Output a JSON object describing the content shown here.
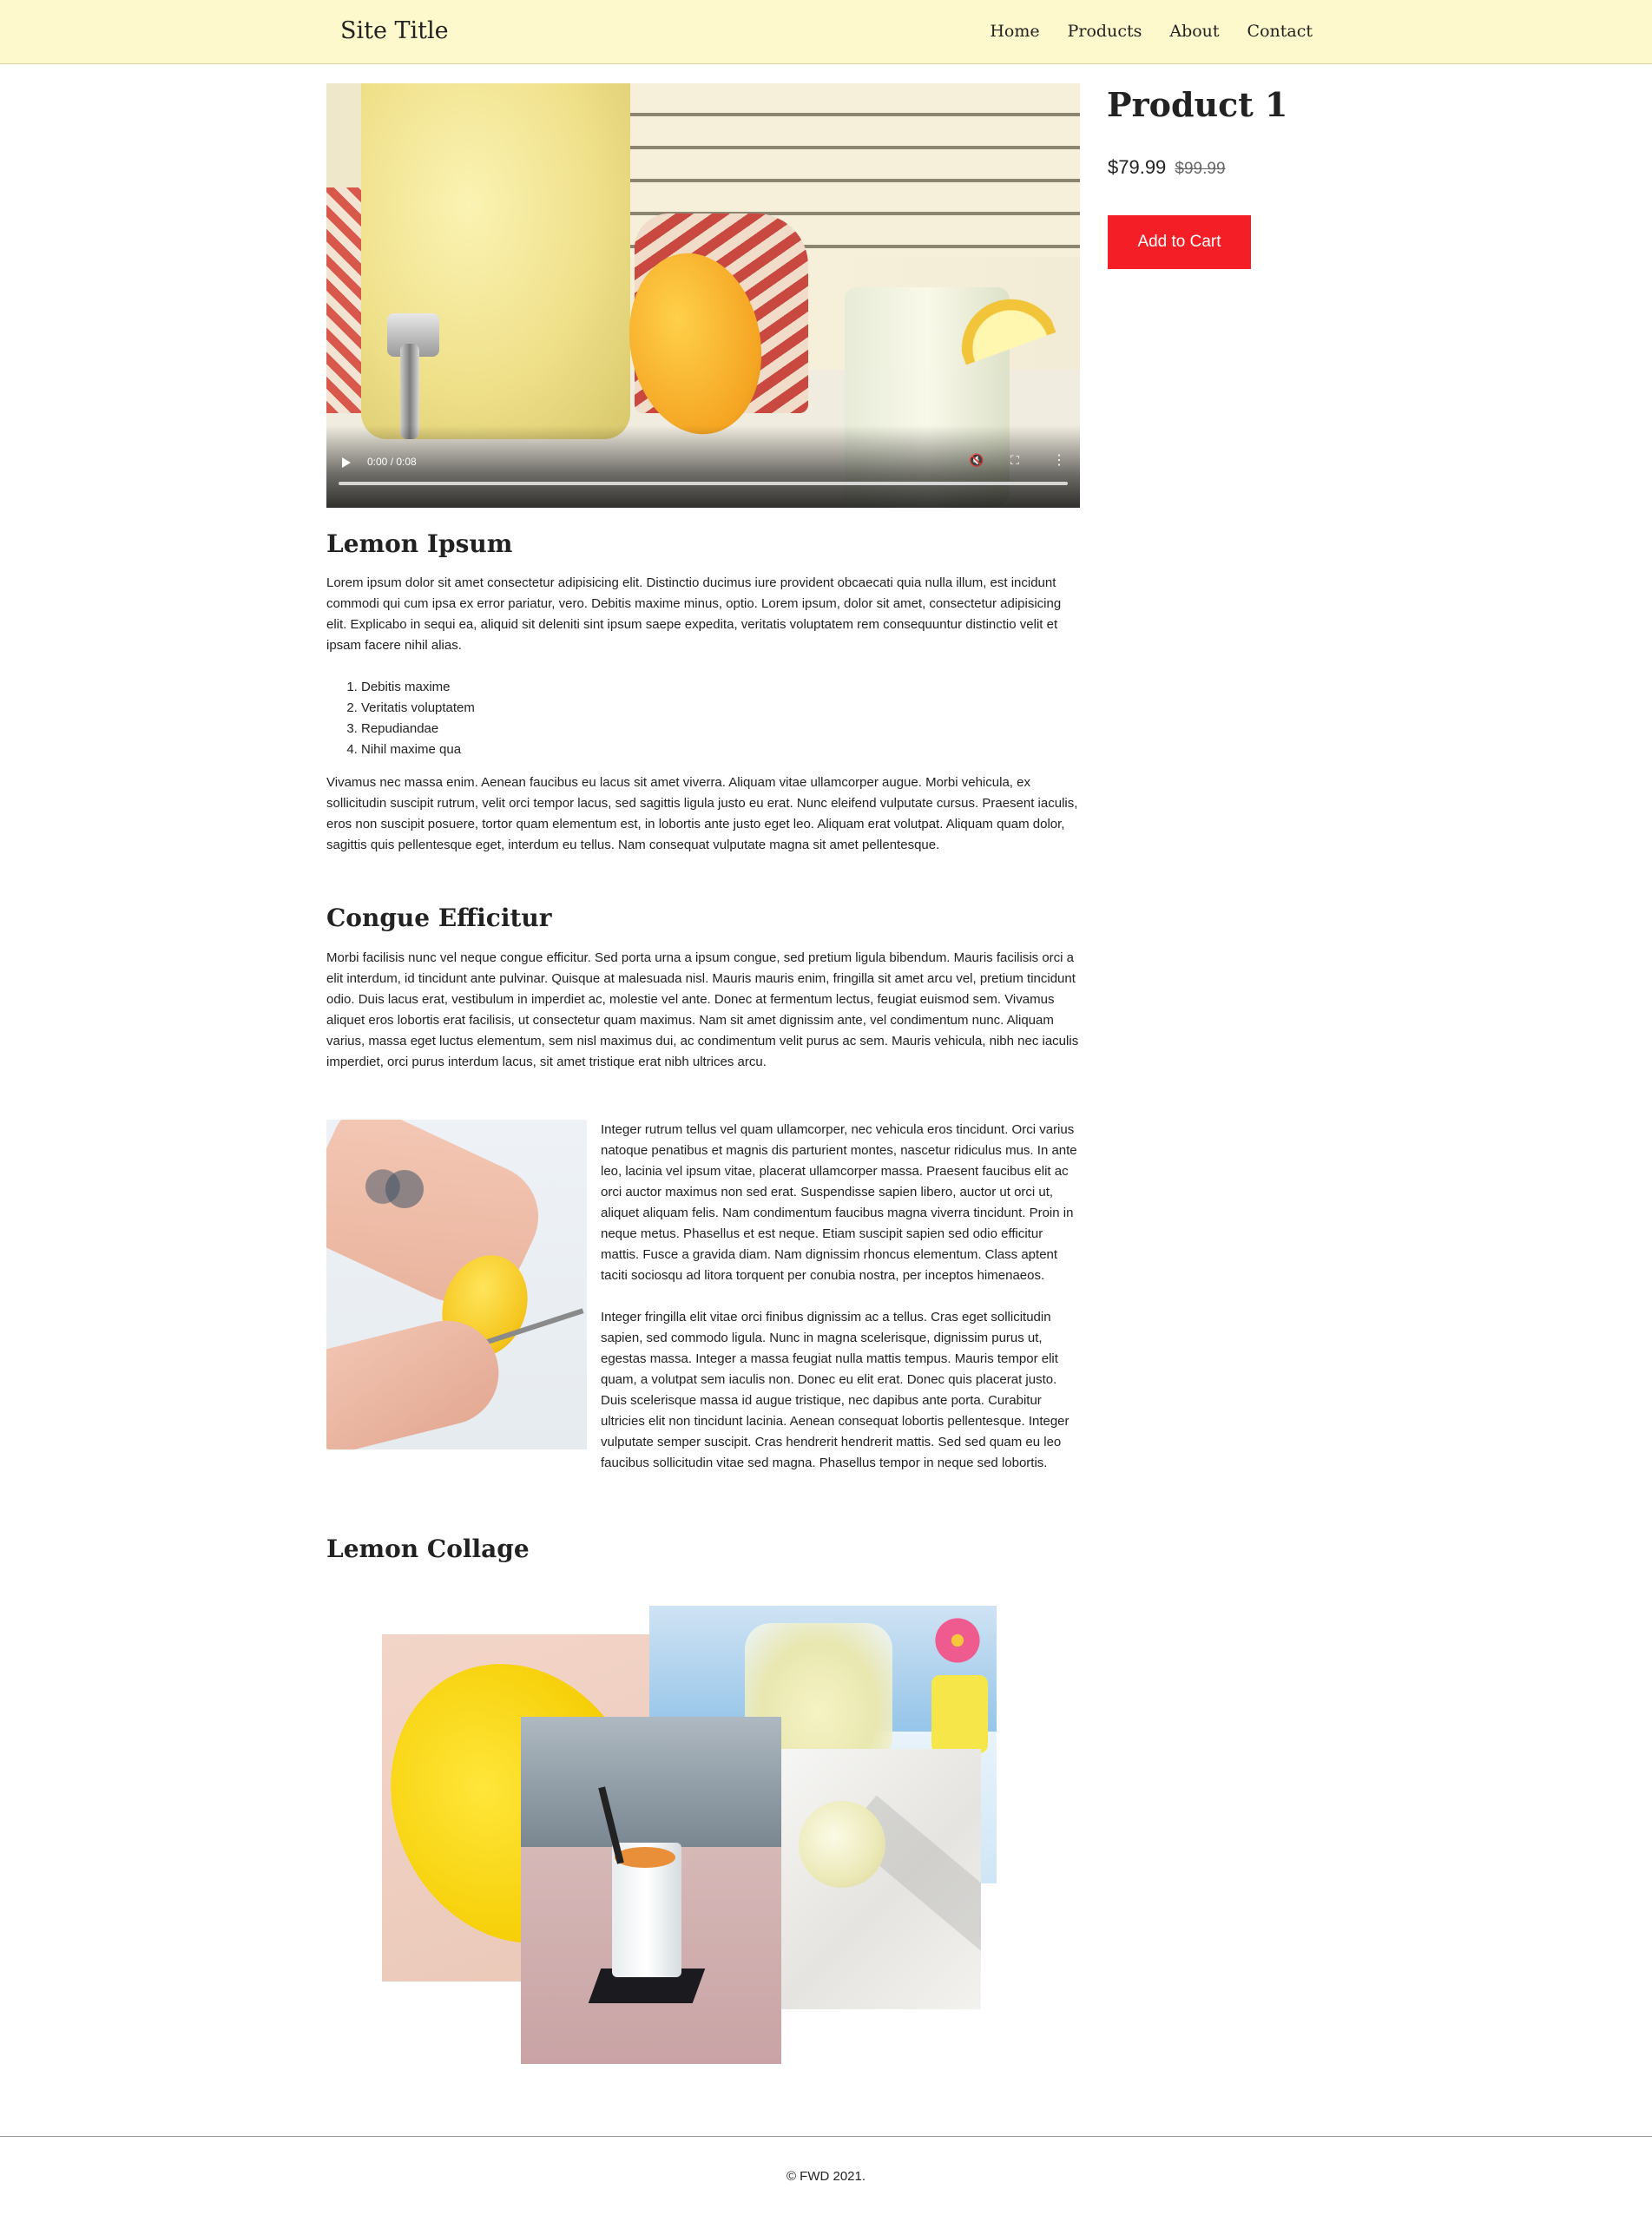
{
  "header": {
    "site_title": "Site Title",
    "nav": [
      "Home",
      "Products",
      "About",
      "Contact"
    ]
  },
  "video": {
    "time": "0:00 / 0:08",
    "progress": 0
  },
  "product": {
    "title": "Product 1",
    "price": "$79.99",
    "old_price": "$99.99",
    "cart_label": "Add to Cart",
    "cart_color": "#f41f26"
  },
  "article": {
    "heading1": "Lemon Ipsum",
    "para1": "Lorem ipsum dolor sit amet consectetur adipisicing elit. Distinctio ducimus iure provident obcaecati quia nulla illum, est incidunt commodi qui cum ipsa ex error pariatur, vero. Debitis maxime minus, optio. Lorem ipsum, dolor sit amet, consectetur adipisicing elit. Explicabo in sequi ea, aliquid sit deleniti sint ipsum saepe expedita, veritatis voluptatem rem consequuntur distinctio velit et ipsam facere nihil alias.",
    "list": [
      "Debitis maxime",
      "Veritatis voluptatem",
      "Repudiandae",
      "Nihil maxime qua"
    ],
    "para2": "Vivamus nec massa enim. Aenean faucibus eu lacus sit amet viverra. Aliquam vitae ullamcorper augue. Morbi vehicula, ex sollicitudin suscipit rutrum, velit orci tempor lacus, sed sagittis ligula justo eu erat. Nunc eleifend vulputate cursus. Praesent iaculis, eros non suscipit posuere, tortor quam elementum est, in lobortis ante justo eget leo. Aliquam erat volutpat. Aliquam quam dolor, sagittis quis pellentesque eget, interdum eu tellus. Nam consequat vulputate magna sit amet pellentesque.",
    "heading2": "Congue Efficitur",
    "para3": "Morbi facilisis nunc vel neque congue efficitur. Sed porta urna a ipsum congue, sed pretium ligula bibendum. Mauris facilisis orci a elit interdum, id tincidunt ante pulvinar. Quisque at malesuada nisl. Mauris mauris enim, fringilla sit amet arcu vel, pretium tincidunt odio. Duis lacus erat, vestibulum in imperdiet ac, molestie vel ante. Donec at fermentum lectus, feugiat euismod sem. Vivamus aliquet eros lobortis erat facilisis, ut consectetur quam maximus. Nam sit amet dignissim ante, vel condimentum nunc. Aliquam varius, massa eget luctus elementum, sem nisl maximus dui, ac condimentum velit purus ac sem. Mauris vehicula, nibh nec iaculis imperdiet, orci purus interdum lacus, sit amet tristique erat nibh ultrices arcu.",
    "para4": "Integer rutrum tellus vel quam ullamcorper, nec vehicula eros tincidunt. Orci varius natoque penatibus et magnis dis parturient montes, nascetur ridiculus mus. In ante leo, lacinia vel ipsum vitae, placerat ullamcorper massa. Praesent faucibus elit ac orci auctor maximus non sed erat. Suspendisse sapien libero, auctor ut orci ut, aliquet aliquam felis. Nam condimentum faucibus magna viverra tincidunt. Proin in neque metus. Phasellus et est neque. Etiam suscipit sapien sed odio efficitur mattis. Fusce a gravida diam. Nam dignissim rhoncus elementum. Class aptent taciti sociosqu ad litora torquent per conubia nostra, per inceptos himenaeos.",
    "para5": "Integer fringilla elit vitae orci finibus dignissim ac a tellus. Cras eget sollicitudin sapien, sed commodo ligula. Nunc in magna scelerisque, dignissim purus ut, egestas massa. Integer a massa feugiat nulla mattis tempus. Mauris tempor elit quam, a volutpat sem iaculis non. Donec eu elit erat. Donec quis placerat justo. Duis scelerisque massa id augue tristique, nec dapibus ante porta. Curabitur ultricies elit non tincidunt lacinia. Aenean consequat lobortis pellentesque. Integer vulputate semper suscipit. Cras hendrerit hendrerit mattis. Sed sed quam eu leo faucibus sollicitudin vitae sed magna. Phasellus tempor in neque sed lobortis.",
    "heading3": "Lemon Collage"
  },
  "footer": {
    "text": "© FWD 2021."
  }
}
